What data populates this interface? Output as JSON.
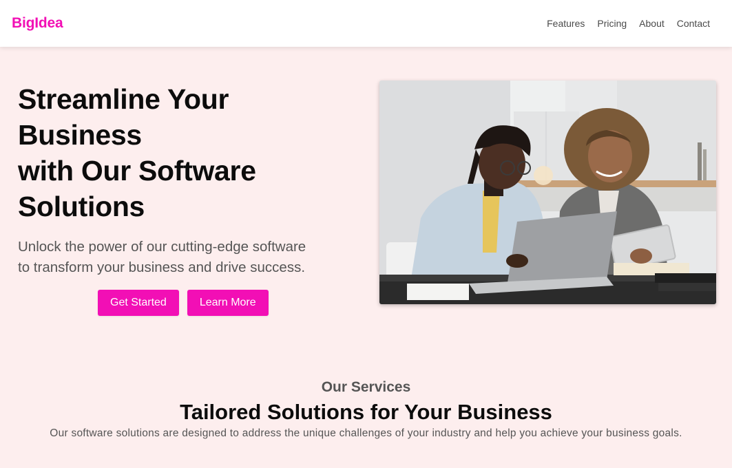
{
  "nav": {
    "brand": "BigIdea",
    "links": [
      "Features",
      "Pricing",
      "About",
      "Contact"
    ]
  },
  "hero": {
    "title_lines": [
      "Streamline Your",
      "Business",
      "with Our Software",
      "Solutions"
    ],
    "subtitle_lines": [
      "Unlock the power of our cutting-edge software",
      "to transform your business and drive success."
    ],
    "primary_button": "Get Started",
    "secondary_button": "Learn More",
    "image_subject": "two-people-working-on-laptop-photo"
  },
  "services": {
    "eyebrow": "Our Services",
    "heading": "Tailored Solutions for Your Business",
    "description": "Our software solutions are designed to address the unique challenges of your industry and help you achieve your business goals."
  },
  "colors": {
    "accent": "#f20fb5",
    "background": "#fdeeee",
    "navbar": "#ffffff",
    "muted_text": "#555555"
  }
}
